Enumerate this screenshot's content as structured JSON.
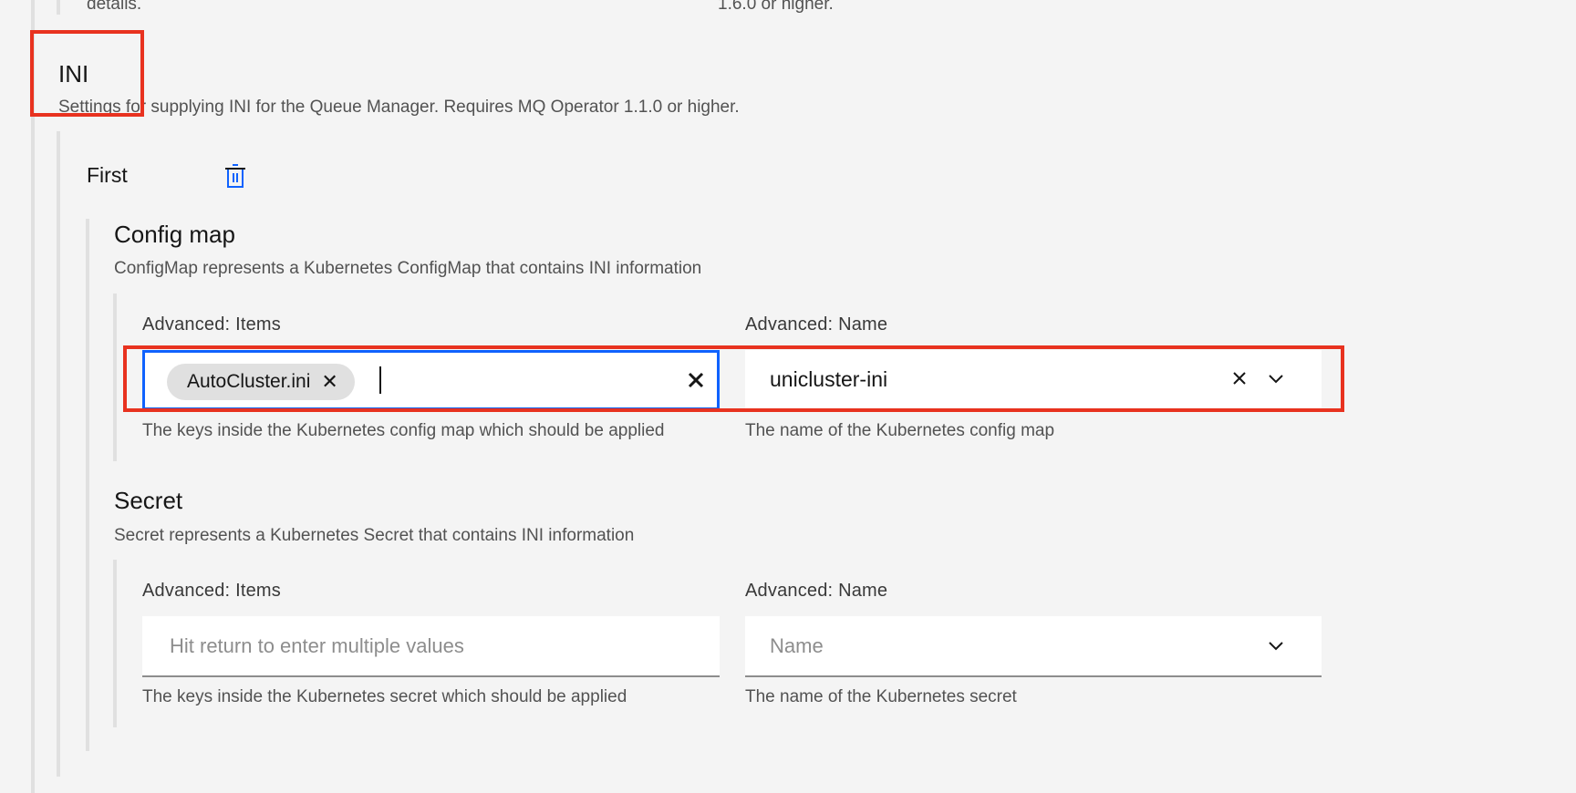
{
  "top_fragment": {
    "left_text": "details.",
    "right_text": "1.6.0 or higher."
  },
  "ini": {
    "title": "INI",
    "description": "Settings for supplying INI for the Queue Manager. Requires MQ Operator 1.1.0 or higher.",
    "group": {
      "name": "First",
      "delete_icon": "trash-can-icon",
      "config_map": {
        "title": "Config map",
        "description": "ConfigMap represents a Kubernetes ConfigMap that contains INI information",
        "items": {
          "label": "Advanced: Items",
          "tags": [
            "AutoCluster.ini"
          ],
          "helper": "The keys inside the Kubernetes config map which should be applied"
        },
        "name": {
          "label": "Advanced: Name",
          "value": "unicluster-ini",
          "helper": "The name of the Kubernetes config map"
        }
      },
      "secret": {
        "title": "Secret",
        "description": "Secret represents a Kubernetes Secret that contains INI information",
        "items": {
          "label": "Advanced: Items",
          "placeholder": "Hit return to enter multiple values",
          "helper": "The keys inside the Kubernetes secret which should be applied"
        },
        "name": {
          "label": "Advanced: Name",
          "placeholder": "Name",
          "helper": "The name of the Kubernetes secret"
        }
      }
    }
  },
  "colors": {
    "background": "#f4f4f4",
    "focus": "#0f62fe",
    "annotation": "#e8321f"
  }
}
